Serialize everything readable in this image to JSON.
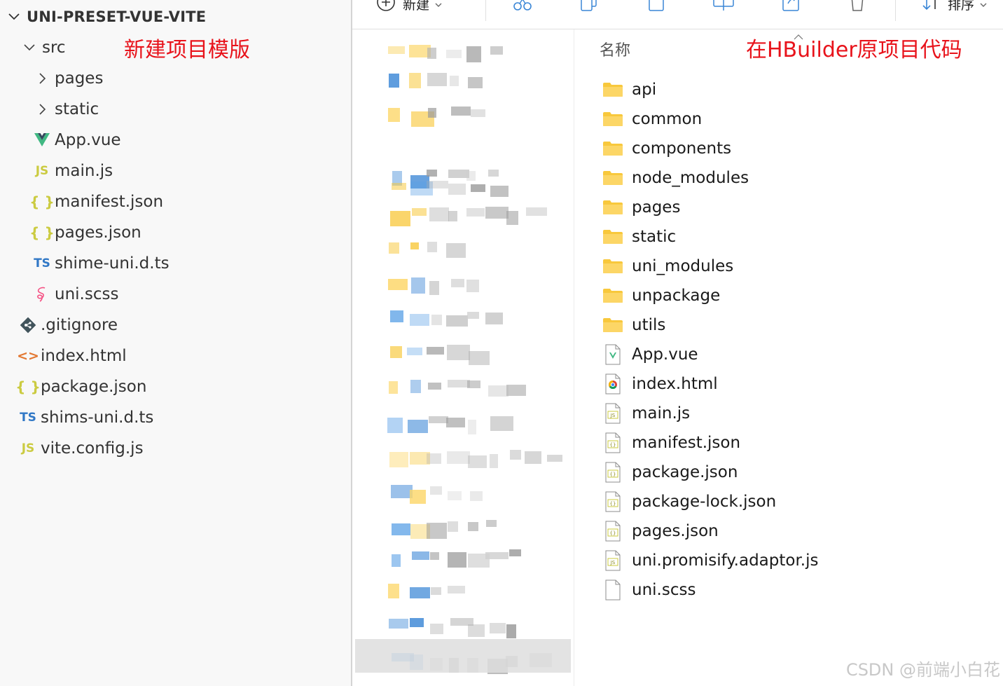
{
  "explorer": {
    "root": "UNI-PRESET-VUE-VITE",
    "items": [
      {
        "label": "src",
        "kind": "folder",
        "expanded": true,
        "depth": 1
      },
      {
        "label": "pages",
        "kind": "folder",
        "expanded": false,
        "depth": 2
      },
      {
        "label": "static",
        "kind": "folder",
        "expanded": false,
        "depth": 2
      },
      {
        "label": "App.vue",
        "kind": "vue",
        "depth": 2
      },
      {
        "label": "main.js",
        "kind": "js",
        "depth": 2
      },
      {
        "label": "manifest.json",
        "kind": "json",
        "depth": 2
      },
      {
        "label": "pages.json",
        "kind": "json",
        "depth": 2
      },
      {
        "label": "shime-uni.d.ts",
        "kind": "ts",
        "depth": 2
      },
      {
        "label": "uni.scss",
        "kind": "sass",
        "depth": 2
      },
      {
        "label": ".gitignore",
        "kind": "git",
        "depth": 1
      },
      {
        "label": "index.html",
        "kind": "html",
        "depth": 1
      },
      {
        "label": "package.json",
        "kind": "json",
        "depth": 1
      },
      {
        "label": "shims-uni.d.ts",
        "kind": "ts",
        "depth": 1
      },
      {
        "label": "vite.config.js",
        "kind": "js",
        "depth": 1
      }
    ],
    "icon_glyphs": {
      "js": "JS",
      "ts": "TS",
      "json": "{ }",
      "html": "<>"
    }
  },
  "annotations": {
    "left": "新建项目模版",
    "right": "在HBuilder原项目代码"
  },
  "toolbar": {
    "new_label": "新建",
    "sort_label": "排序",
    "icons": [
      "plus-circle-icon",
      "cut-icon",
      "copy-icon",
      "paste-icon",
      "rename-icon",
      "share-icon",
      "delete-icon",
      "sort-icon"
    ]
  },
  "file_list": {
    "column_name": "名称",
    "items": [
      {
        "label": "api",
        "kind": "folder"
      },
      {
        "label": "common",
        "kind": "folder"
      },
      {
        "label": "components",
        "kind": "folder"
      },
      {
        "label": "node_modules",
        "kind": "folder"
      },
      {
        "label": "pages",
        "kind": "folder"
      },
      {
        "label": "static",
        "kind": "folder"
      },
      {
        "label": "uni_modules",
        "kind": "folder"
      },
      {
        "label": "unpackage",
        "kind": "folder"
      },
      {
        "label": "utils",
        "kind": "folder"
      },
      {
        "label": "App.vue",
        "kind": "vue"
      },
      {
        "label": "index.html",
        "kind": "html"
      },
      {
        "label": "main.js",
        "kind": "js"
      },
      {
        "label": "manifest.json",
        "kind": "json"
      },
      {
        "label": "package.json",
        "kind": "json"
      },
      {
        "label": "package-lock.json",
        "kind": "json"
      },
      {
        "label": "pages.json",
        "kind": "json"
      },
      {
        "label": "uni.promisify.adaptor.js",
        "kind": "js"
      },
      {
        "label": "uni.scss",
        "kind": "file"
      }
    ]
  },
  "watermark": "CSDN @前端小白花",
  "colors": {
    "annotation": "#e8131b",
    "folder": "#f8c83c",
    "vue": "#41b883",
    "js": "#cbcb41",
    "ts": "#3178c6",
    "html": "#e37933",
    "git": "#41535b",
    "sass": "#f55385"
  }
}
